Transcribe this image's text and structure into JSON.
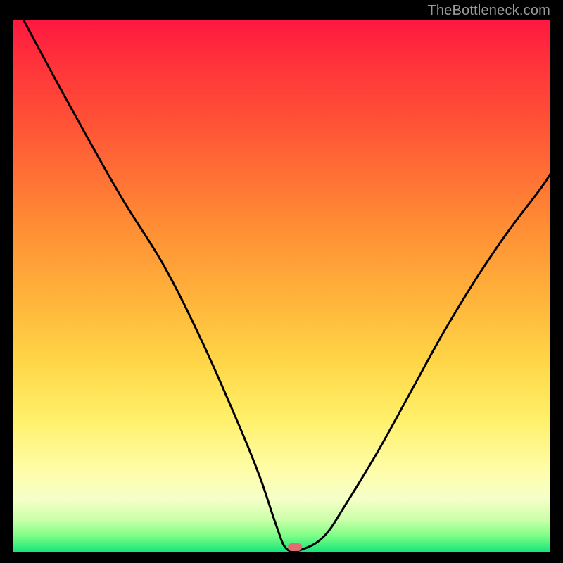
{
  "attribution": "TheBottleneck.com",
  "marker": {
    "x_pct": 52.5,
    "y_pct": 99.1
  },
  "chart_data": {
    "type": "line",
    "title": "",
    "xlabel": "",
    "ylabel": "",
    "xlim": [
      0,
      100
    ],
    "ylim": [
      0,
      100
    ],
    "series": [
      {
        "name": "bottleneck-curve",
        "x": [
          2,
          10,
          20,
          28,
          35,
          42,
          46,
          49,
          51,
          54,
          58,
          62,
          68,
          74,
          80,
          86,
          92,
          98,
          100
        ],
        "y": [
          100,
          85,
          67,
          54,
          40,
          24,
          14,
          5,
          0.5,
          0.5,
          3,
          9,
          19,
          30,
          41,
          51,
          60,
          68,
          71
        ]
      }
    ],
    "annotations": [
      {
        "name": "optimal-marker",
        "x": 52.5,
        "y": 0.9
      }
    ],
    "background_gradient": {
      "direction": "top-to-bottom",
      "stops": [
        {
          "pct": 0,
          "color": "#ff1740"
        },
        {
          "pct": 20,
          "color": "#ff5436"
        },
        {
          "pct": 38,
          "color": "#ff8b34"
        },
        {
          "pct": 64,
          "color": "#ffd546"
        },
        {
          "pct": 84,
          "color": "#fffca4"
        },
        {
          "pct": 97,
          "color": "#7dff86"
        },
        {
          "pct": 100,
          "color": "#18e47a"
        }
      ]
    }
  }
}
